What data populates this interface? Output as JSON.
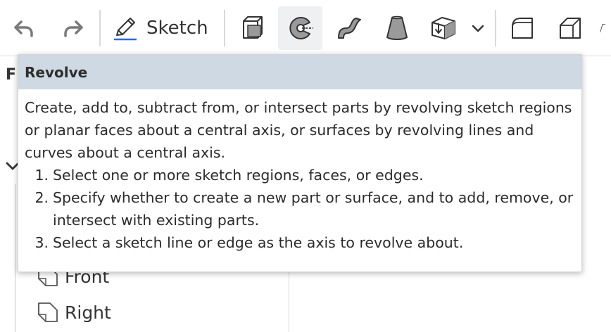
{
  "toolbar": {
    "sketch_label": "Sketch"
  },
  "panel": {
    "title_partial": "F",
    "tree_items": [
      {
        "label": "Front",
        "icon": "plane-icon"
      },
      {
        "label": "Right",
        "icon": "plane-icon"
      }
    ]
  },
  "tooltip": {
    "title": "Revolve",
    "description": "Create, add to, subtract from, or intersect parts by revolving sketch regions or planar faces about a central axis, or surfaces by revolving lines and curves about a central axis.",
    "steps": [
      {
        "num": "1.",
        "text": "Select one or more sketch regions, faces, or edges."
      },
      {
        "num": "2.",
        "text": "Specify whether to create a new part or surface, and to add, remove, or intersect with existing parts."
      },
      {
        "num": "3.",
        "text": "Select a sketch line or edge as the axis to revolve about."
      }
    ]
  },
  "colors": {
    "tooltip_header_bg": "#ced9e4",
    "active_tool_bg": "#eef0f2",
    "sketch_underline": "#2f6bd1",
    "icon_fill": "#9a9a9a",
    "icon_stroke": "#333333"
  }
}
